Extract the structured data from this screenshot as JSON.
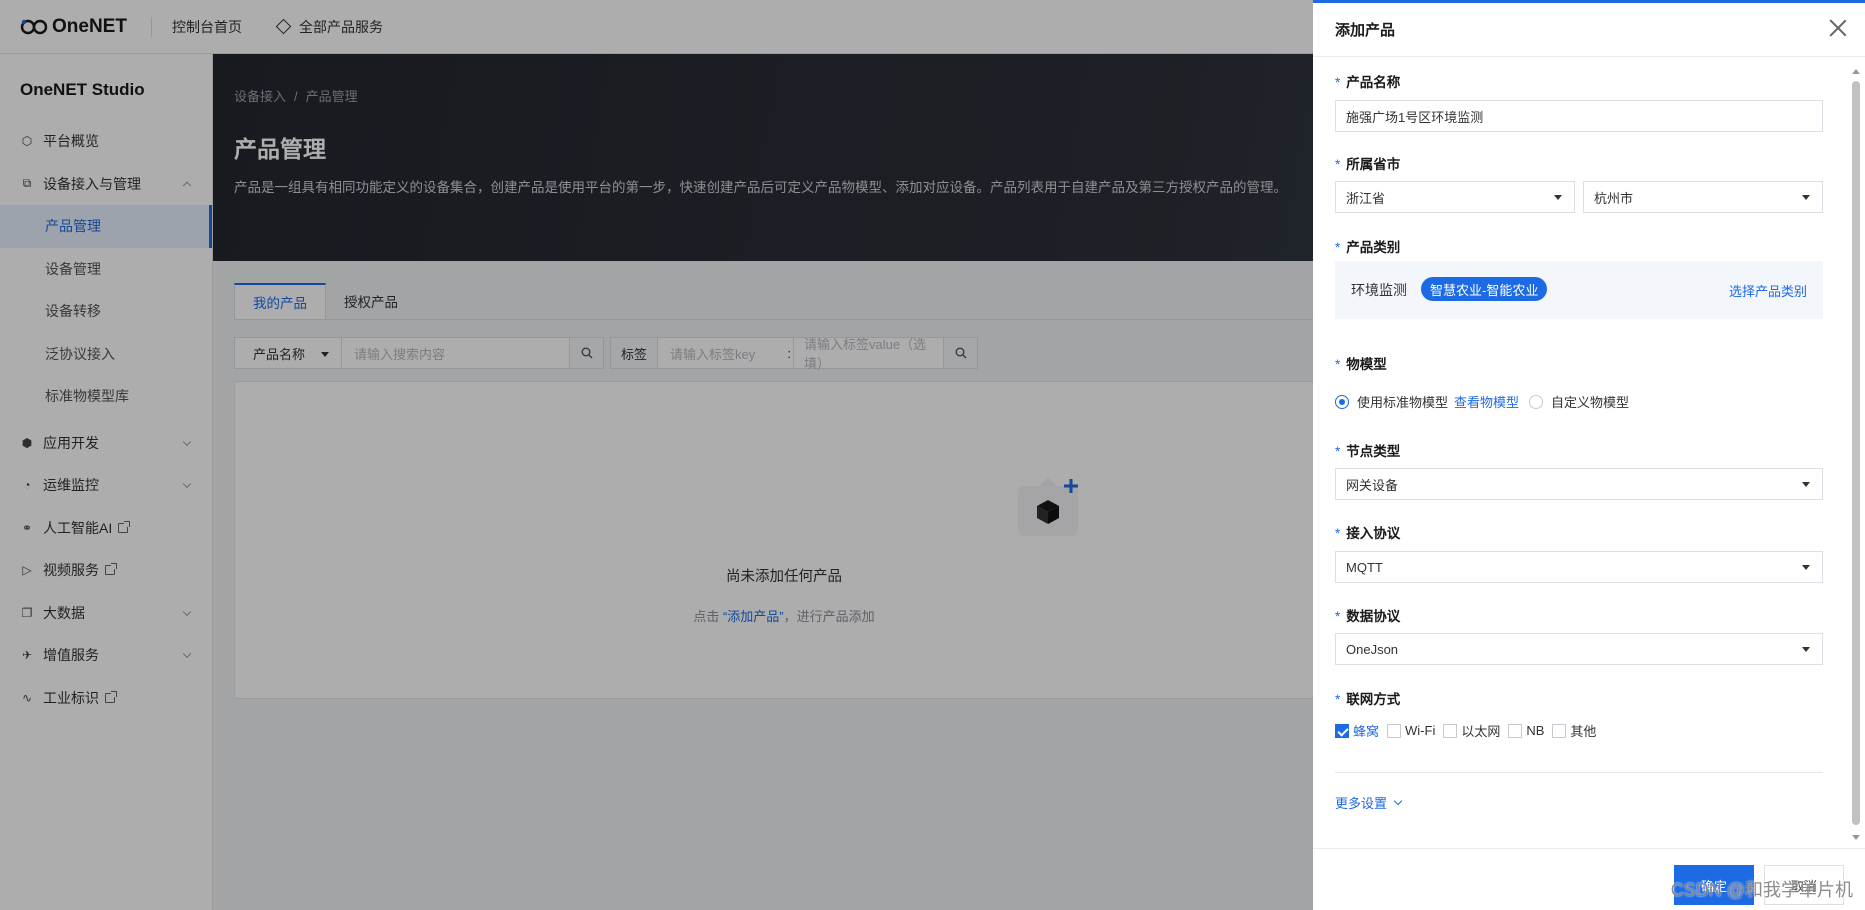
{
  "topbar": {
    "logo_text": "OneNET",
    "console_home": "控制台首页",
    "all_products": "全部产品服务"
  },
  "sidebar": {
    "title": "OneNET Studio",
    "items": [
      {
        "label": "平台概览",
        "icon": "hexagon-icon"
      },
      {
        "label": "设备接入与管理",
        "icon": "device-icon",
        "expanded": true
      },
      {
        "label": "应用开发",
        "icon": "cube-icon"
      },
      {
        "label": "运维监控",
        "icon": "monitor-icon"
      },
      {
        "label": "人工智能AI",
        "icon": "ai-icon",
        "external": true
      },
      {
        "label": "视频服务",
        "icon": "video-icon",
        "external": true
      },
      {
        "label": "大数据",
        "icon": "bigdata-icon"
      },
      {
        "label": "增值服务",
        "icon": "plane-icon"
      },
      {
        "label": "工业标识",
        "icon": "industry-icon",
        "external": true
      }
    ],
    "sub_items": [
      "产品管理",
      "设备管理",
      "设备转移",
      "泛协议接入",
      "标准物模型库"
    ]
  },
  "main": {
    "breadcrumb": [
      "设备接入",
      "产品管理"
    ],
    "title": "产品管理",
    "description": "产品是一组具有相同功能定义的设备集合，创建产品是使用平台的第一步，快速创建产品后可定义产品物模型、添加对应设备。产品列表用于自建产品及第三方授权产品的管理。",
    "tabs": [
      "我的产品",
      "授权产品"
    ],
    "filter": {
      "field_select": "产品名称",
      "search_placeholder": "请输入搜索内容",
      "tag_label": "标签",
      "tag_key_placeholder": "请输入标签key",
      "tag_value_placeholder": "请输入标签value（选填）"
    },
    "empty": {
      "title": "尚未添加任何产品",
      "hint_prefix": "点击",
      "hint_link": "“添加产品”",
      "hint_suffix": "，进行产品添加"
    }
  },
  "drawer": {
    "title": "添加产品",
    "product_name_label": "产品名称",
    "product_name_value": "施强广场1号区环境监测",
    "region_label": "所属省市",
    "province": "浙江省",
    "city": "杭州市",
    "category_label": "产品类别",
    "category_text": "环境监测",
    "category_badge": "智慧农业-智能农业",
    "category_link": "选择产品类别",
    "model_label": "物模型",
    "model_standard": "使用标准物模型",
    "model_view_link": "查看物模型",
    "model_custom": "自定义物模型",
    "node_label": "节点类型",
    "node_value": "网关设备",
    "protocol_label": "接入协议",
    "protocol_value": "MQTT",
    "data_protocol_label": "数据协议",
    "data_protocol_value": "OneJson",
    "network_label": "联网方式",
    "network_options": [
      {
        "label": "蜂窝",
        "checked": true
      },
      {
        "label": "Wi-Fi",
        "checked": false
      },
      {
        "label": "以太网",
        "checked": false
      },
      {
        "label": "NB",
        "checked": false
      },
      {
        "label": "其他",
        "checked": false
      }
    ],
    "more_settings": "更多设置",
    "ok": "确定",
    "cancel": "取消"
  },
  "watermark": "CSDN @和我学单片机",
  "colors": {
    "accent": "#1d6ae5",
    "banner": "#2b3038"
  }
}
